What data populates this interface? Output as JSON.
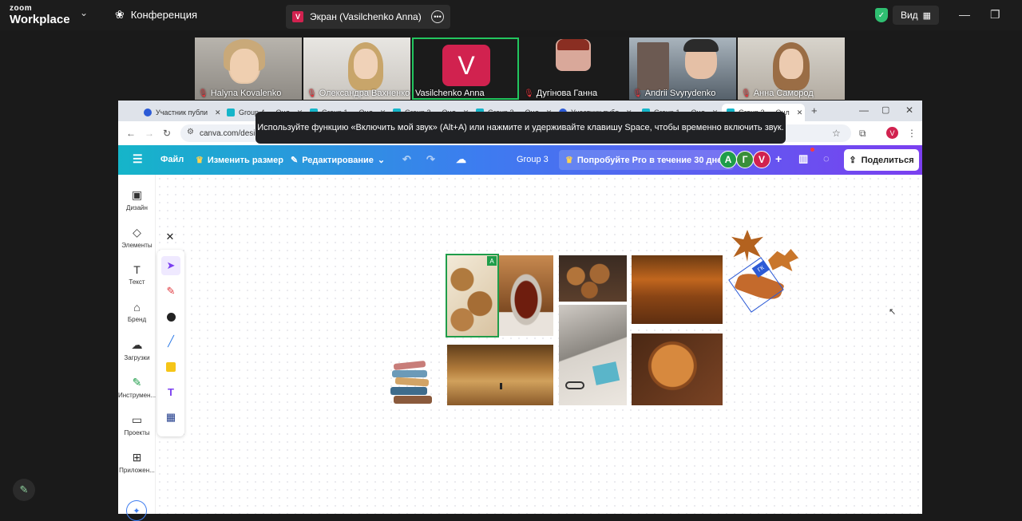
{
  "zoom": {
    "logo_line1": "zoom",
    "logo_line2": "Workplace",
    "meeting_title": "Конференция",
    "screen_share_badge": "V",
    "screen_share_label": "Экран (Vasilchenko Anna)",
    "view_label": "Вид"
  },
  "participants": [
    {
      "name": "Halyna Kovalenko"
    },
    {
      "name": "Олександра Вахненко"
    },
    {
      "name": "Vasilchenko Anna",
      "initial": "V"
    },
    {
      "name": "Дугінова Ганна"
    },
    {
      "name": "Andrii Svyrydenko"
    },
    {
      "name": "Анна Самород"
    }
  ],
  "browser": {
    "tabs": [
      {
        "label": "Участник публи"
      },
      {
        "label": "Group 4 — Онл"
      },
      {
        "label": "Group 1 — Онл"
      },
      {
        "label": "Group 2 — Онл"
      },
      {
        "label": "Group 3 — Онл"
      },
      {
        "label": "Участник публ"
      },
      {
        "label": "Group 1 — Онл"
      },
      {
        "label": "Group 3 — Онл"
      }
    ],
    "url": "canva.com/design/",
    "toast": "Используйте функцию «Включить мой звук» (Alt+A) или нажмите и удерживайте клавишу Space, чтобы временно включить звук.",
    "profile_initial": "V"
  },
  "canva": {
    "file": "Файл",
    "resize": "Изменить размер",
    "editing": "Редактирование",
    "doc_title": "Group 3",
    "try_pro": "Попробуйте Pro в течение 30 дней",
    "avatars": [
      {
        "letter": "A",
        "color": "#1f9d4a"
      },
      {
        "letter": "Г",
        "color": "#3a8f3a"
      },
      {
        "letter": "V",
        "color": "#d1224f"
      }
    ],
    "share": "Поделиться",
    "sidebar": [
      {
        "label": "Дизайн",
        "icon": "▣"
      },
      {
        "label": "Элементы",
        "icon": "◇"
      },
      {
        "label": "Текст",
        "icon": "T"
      },
      {
        "label": "Бренд",
        "icon": "⌂"
      },
      {
        "label": "Загрузки",
        "icon": "☁"
      },
      {
        "label": "Инструмен...",
        "icon": "✎"
      },
      {
        "label": "Проекты",
        "icon": "▭"
      },
      {
        "label": "Приложен...",
        "icon": "⊞"
      }
    ],
    "selection_badge": "A",
    "leaf_badge": "ГК"
  },
  "colors": {
    "accent_green": "#22c55e",
    "canva_purple": "#7b3ff0",
    "canva_teal": "#15b5c9"
  }
}
